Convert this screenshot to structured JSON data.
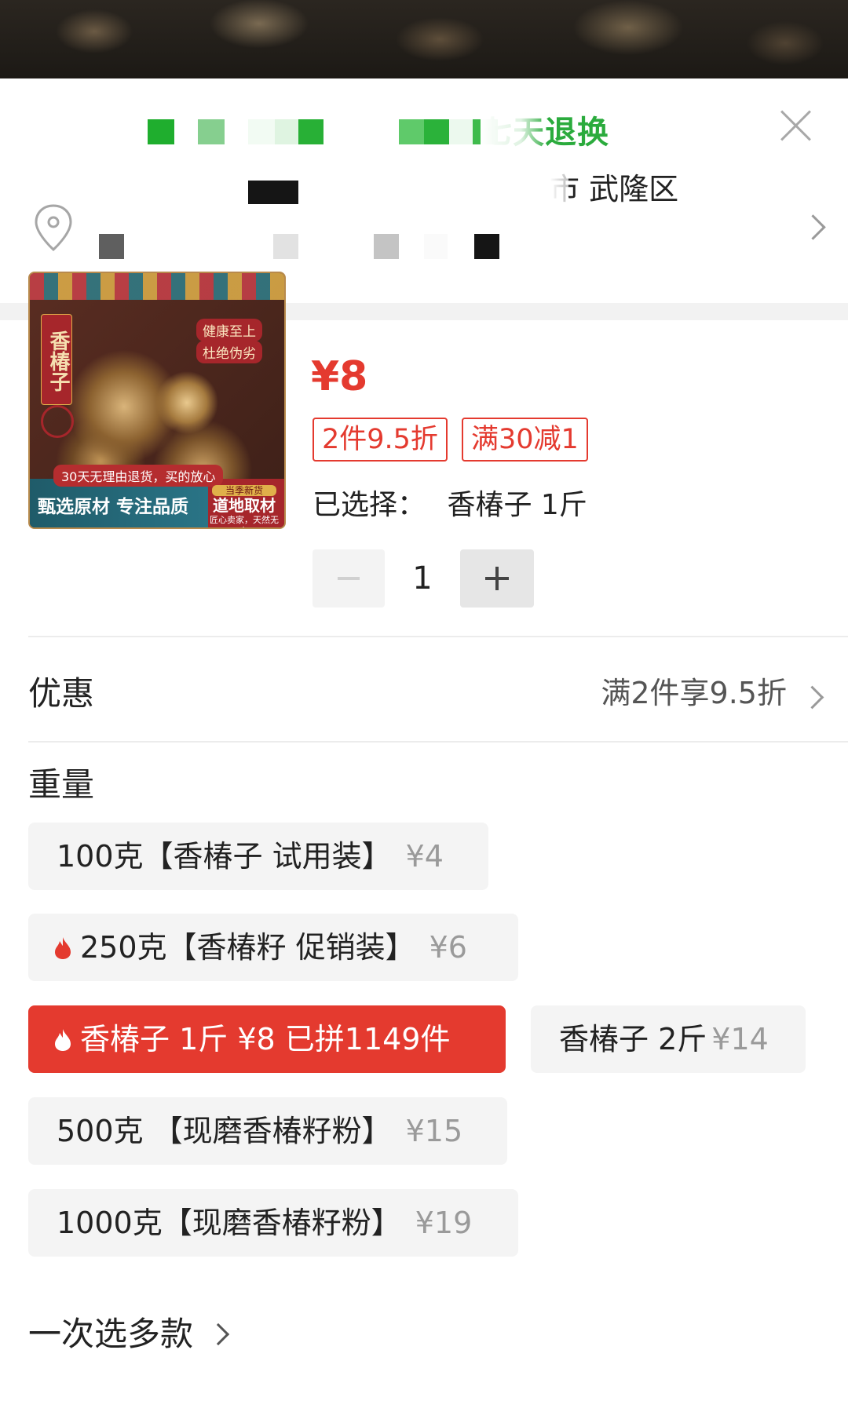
{
  "header": {
    "notice_visible_text": "七天退换"
  },
  "address": {
    "district_text": "市 武隆区"
  },
  "product": {
    "image": {
      "side_title": "香椿子",
      "tag_1": "健康至上",
      "tag_2": "杜绝伪劣",
      "ribbon": "30天无理由退货，买的放心",
      "bottom_left": "甄选原材 专注品质",
      "badge_top": "当季新货",
      "bottom_right": "道地取材",
      "bottom_right_small": "匠心卖家，天然无杂"
    },
    "price": "¥8",
    "promo_tags": [
      "2件9.5折",
      "满30减1"
    ],
    "selected_label": "已选择：",
    "selected_value": "香椿子 1斤",
    "quantity": "1"
  },
  "discount": {
    "label": "优惠",
    "value": "满2件享9.5折"
  },
  "weight": {
    "label": "重量",
    "options": [
      {
        "name": "100克【香椿子 试用装】",
        "price": "¥4"
      },
      {
        "name": "250克【香椿籽 促销装】",
        "price": "¥6"
      },
      {
        "name": "香椿子 1斤 ¥8  已拼1149件",
        "price": ""
      },
      {
        "name": "香椿子 2斤",
        "price": "¥14"
      },
      {
        "name": "500克 【现磨香椿籽粉】",
        "price": "¥15"
      },
      {
        "name": "1000克【现磨香椿籽粉】",
        "price": "¥19"
      }
    ],
    "selected_index": 2
  },
  "multi_select": {
    "label": "一次选多款"
  },
  "colors": {
    "accent_red": "#e43a2f",
    "notice_green": "#2bab3d"
  },
  "icons": [
    "close-icon",
    "location-pin-icon",
    "chevron-right-icon",
    "flame-icon",
    "minus-icon",
    "plus-icon"
  ]
}
